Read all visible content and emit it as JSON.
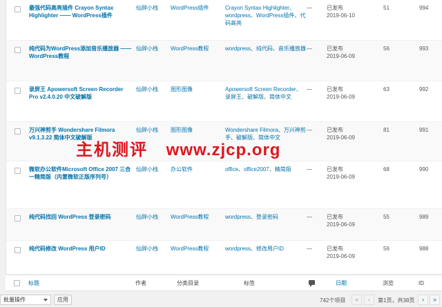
{
  "rows": [
    {
      "title": "最强代码高亮插件 Crayon Syntax Highlighter —— WordPress插件",
      "author": "仙辞小栈",
      "category": "WordPress插件",
      "tags": "Crayon Syntax Highlighter、wordpress、WordPress插件、代码高亮",
      "comments": "—",
      "status": "已发布",
      "date": "2019-06-10",
      "views": "51",
      "id": "994"
    },
    {
      "title": "纯代码为WordPress添加音乐播放器 —— WordPress教程",
      "author": "仙辞小栈",
      "category": "WordPress教程",
      "tags": "wordpress、纯代码、音乐播放器",
      "comments": "—",
      "status": "已发布",
      "date": "2019-06-09",
      "views": "56",
      "id": "993"
    },
    {
      "title": "录屏王 Apowersoft Screen Recorder Pro v2.4.0.20 中文破解版",
      "author": "仙辞小栈",
      "category": "图形图像",
      "tags": "Apowersoft Screen Recorder、录屏王、破解版、简体中文",
      "comments": "—",
      "status": "已发布",
      "date": "2019-06-09",
      "views": "63",
      "id": "992"
    },
    {
      "title": "万兴神剪手 Wondershare Filmora v9.1.3.22 简体中文破解版",
      "author": "仙辞小栈",
      "category": "图形图像",
      "tags": "Wondershare Filmora、万兴神剪手、破解版、简体中文",
      "comments": "—",
      "status": "已发布",
      "date": "2019-06-09",
      "views": "81",
      "id": "991"
    },
    {
      "title": "微软办公软件Microsoft Office 2007 三合一精简版（内置微软正版序列号）",
      "author": "仙辞小栈",
      "category": "办公软件",
      "tags": "office、office2007、精简版",
      "comments": "—",
      "status": "已发布",
      "date": "2019-06-09",
      "views": "68",
      "id": "990"
    },
    {
      "title": "纯代码找回 WordPress 登录密码",
      "author": "仙辞小栈",
      "category": "WordPress教程",
      "tags": "wordpress、登录密码",
      "comments": "—",
      "status": "已发布",
      "date": "2019-06-09",
      "views": "55",
      "id": "989"
    },
    {
      "title": "纯代码修改 WordPress 用户ID",
      "author": "仙辞小栈",
      "category": "WordPress教程",
      "tags": "wordpress、修改用户ID",
      "comments": "—",
      "status": "已发布",
      "date": "2019-06-09",
      "views": "56",
      "id": "988"
    }
  ],
  "footer": {
    "title": "标题",
    "author": "作者",
    "category": "分类目录",
    "tags": "标签",
    "date": "日期",
    "views": "浏览",
    "id": "ID",
    "comment_icon": "comment-icon"
  },
  "bulk": {
    "label": "批量操作",
    "apply": "应用"
  },
  "pagination": {
    "count": "742个项目",
    "first": "«",
    "prev": "‹",
    "page_text": "第1页，共38页",
    "next": "›",
    "last": "»"
  },
  "watermark": {
    "left": "主机测评",
    "right": "www.zjcp.org"
  }
}
